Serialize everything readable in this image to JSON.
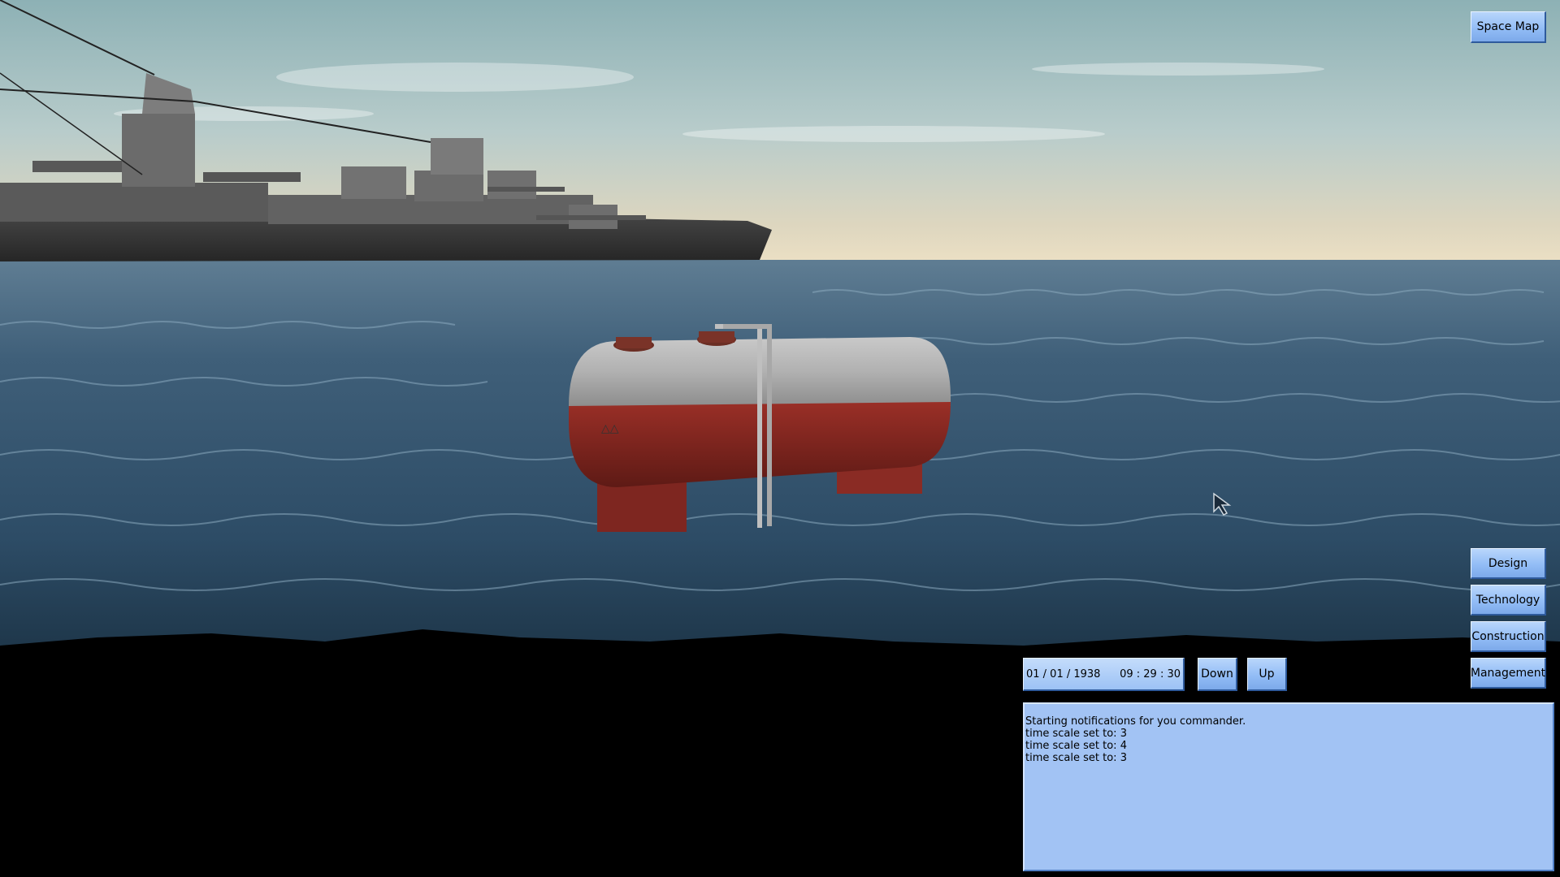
{
  "top_right": {
    "space_map_label": "Space Map"
  },
  "side_menu": {
    "design_label": "Design",
    "technology_label": "Technology",
    "construction_label": "Construction",
    "management_label": "Management"
  },
  "time_control": {
    "date": "01 / 01 / 1938",
    "clock": "09 : 29 : 30",
    "down_label": "Down",
    "up_label": "Up"
  },
  "notifications": [
    "Starting notifications for you commander.",
    "time scale set to: 3",
    "time scale set to: 4",
    "time scale set to: 3"
  ],
  "colors": {
    "button_fill": "#93bdf6",
    "panel_fill": "#a2c3f4",
    "sky_top": "#8fb3b6",
    "horizon": "#e8dcc0",
    "sea": "#2a4a63"
  }
}
